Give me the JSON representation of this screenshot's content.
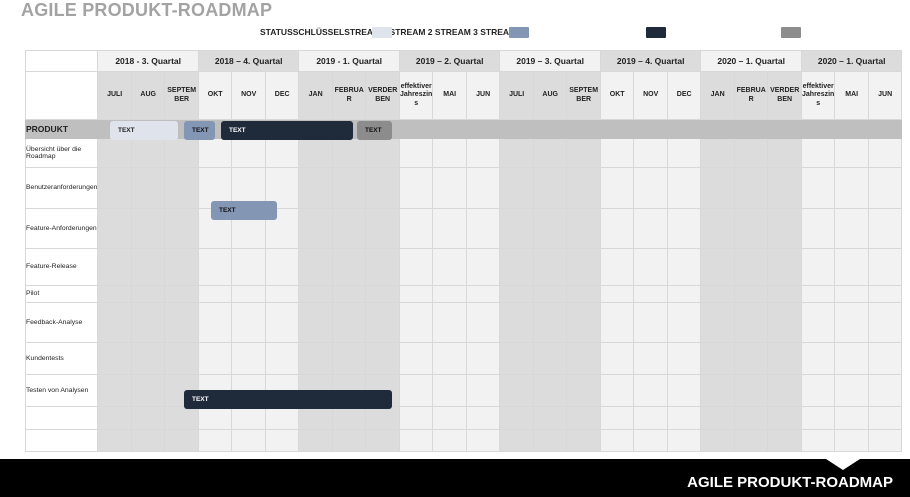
{
  "title": "AGILE PRODUKT-ROADMAP",
  "legend": {
    "text": "STATUSSCHLÜSSELSTREAM 1 STREAM 2 STREAM 3 STREAM 4",
    "colors": {
      "stream1": "#dfe3ec",
      "stream2": "#8396b4",
      "stream3": "#1f2a3a",
      "stream4": "#8c8c8c"
    }
  },
  "quarters": [
    "2018 - 3. Quartal",
    "2018 – 4. Quartal",
    "2019 - 1. Quartal",
    "2019 – 2. Quartal",
    "2019 – 3. Quartal",
    "2019 – 4. Quartal",
    "2020 – 1. Quartal",
    "2020 – 1. Quartal"
  ],
  "months": [
    "JULI",
    "AUG",
    "SEPTEMBER",
    "OKT",
    "NOV",
    "DEC",
    "JAN",
    "FEBRUAR",
    "VERDERBEN",
    "effektiver Jahreszins",
    "MAI",
    "JUN",
    "JULI",
    "AUG",
    "SEPTEMBER",
    "OKT",
    "NOV",
    "DEC",
    "JAN",
    "FEBRUAR",
    "VERDERBEN",
    "effektiver Jahreszins",
    "MAI",
    "JUN"
  ],
  "product_label": "PRODUKT",
  "rows": [
    "Übersicht über die Roadmap",
    "Benutzeranforderungen",
    "Feature-Anforderungen",
    "Feature-Release",
    "Pilot",
    "Feedback-Analyse",
    "Kundentests",
    "Testen von Analysen",
    "",
    ""
  ],
  "bars": [
    {
      "label": "TEXT",
      "stream": "stream1"
    },
    {
      "label": "TEXT",
      "stream": "stream2"
    },
    {
      "label": "TEXT",
      "stream": "stream3"
    },
    {
      "label": "TEXT",
      "stream": "stream4"
    },
    {
      "label": "TEXT",
      "stream": "stream2"
    },
    {
      "label": "TEXT",
      "stream": "stream3"
    }
  ],
  "footer": {
    "title": "AGILE PRODUKT-ROADMAP"
  }
}
